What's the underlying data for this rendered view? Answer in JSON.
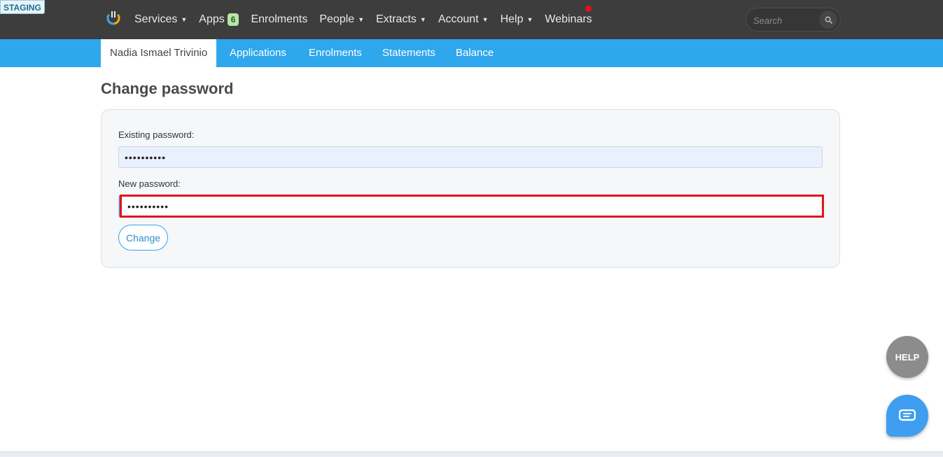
{
  "env_badge": "STAGING",
  "topnav": {
    "items": [
      {
        "label": "Services",
        "has_caret": true
      },
      {
        "label": "Apps",
        "badge": "6"
      },
      {
        "label": "Enrolments"
      },
      {
        "label": "People",
        "has_caret": true
      },
      {
        "label": "Extracts",
        "has_caret": true
      },
      {
        "label": "Account",
        "has_caret": true
      },
      {
        "label": "Help",
        "has_caret": true
      },
      {
        "label": "Webinars",
        "notification_dot": true
      }
    ],
    "search_placeholder": "Search",
    "search_icon": "search-icon",
    "logo_icon": "app-logo-icon"
  },
  "subnav": {
    "items": [
      {
        "label": "Nadia Ismael Trivinio",
        "active": true
      },
      {
        "label": "Applications"
      },
      {
        "label": "Enrolments"
      },
      {
        "label": "Statements"
      },
      {
        "label": "Balance"
      }
    ]
  },
  "main": {
    "title": "Change password",
    "existing_label": "Existing password:",
    "existing_value": "••••••••••",
    "new_label": "New password:",
    "new_value": "••••••••••",
    "change_button": "Change"
  },
  "floating": {
    "help_label": "HELP",
    "chat_icon": "chat-icon"
  },
  "colors": {
    "topbar": "#3d3d3d",
    "subbar": "#2ea7ec",
    "highlight": "#e0141e",
    "notification": "#e8101c"
  }
}
